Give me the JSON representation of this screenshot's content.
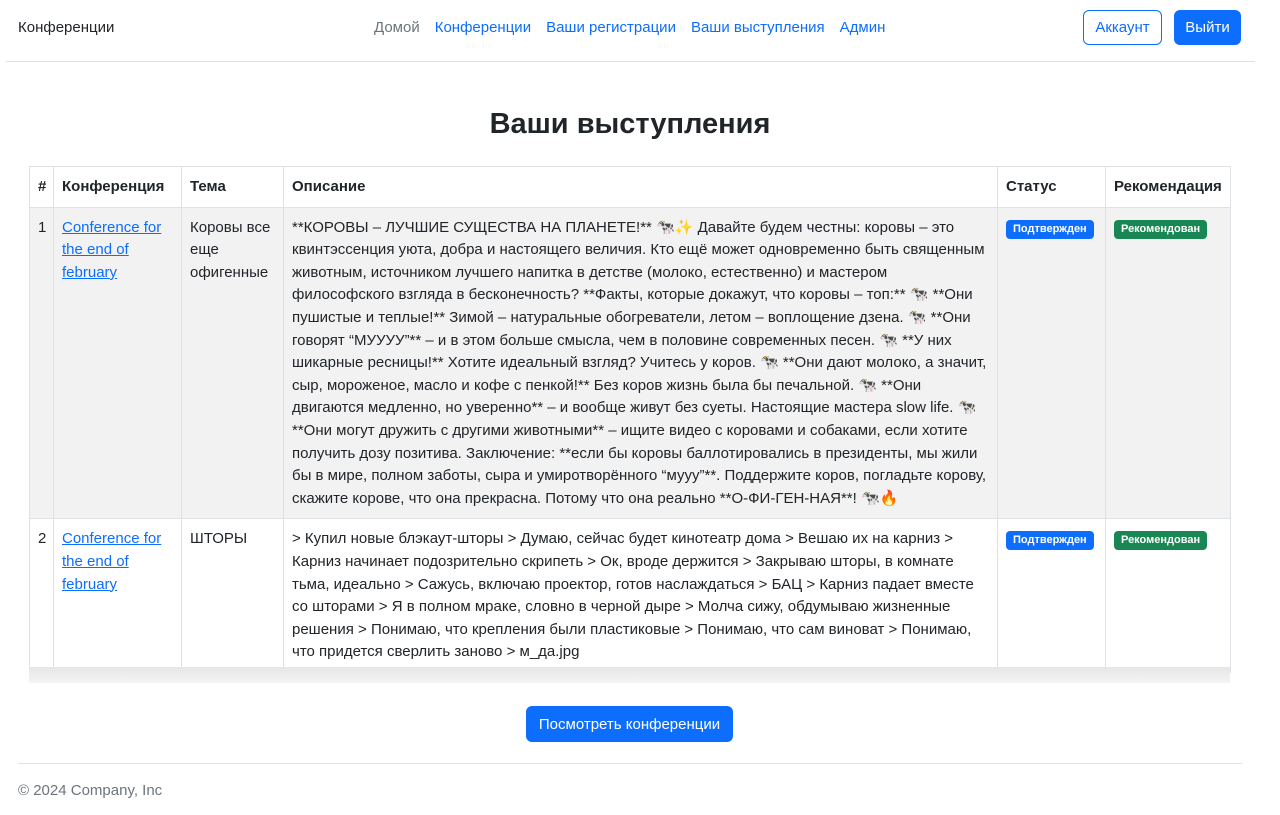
{
  "header": {
    "brand": "Конференции",
    "nav": [
      {
        "label": "Домой"
      },
      {
        "label": "Конференции"
      },
      {
        "label": "Ваши регистрации"
      },
      {
        "label": "Ваши выступления"
      },
      {
        "label": "Админ"
      }
    ],
    "account_label": "Аккаунт",
    "logout_label": "Выйти"
  },
  "page": {
    "title": "Ваши выступления"
  },
  "table": {
    "headers": [
      "#",
      "Конференция",
      "Тема",
      "Описание",
      "Статус",
      "Рекомендация"
    ],
    "rows": [
      {
        "num": "1",
        "conference": "Conference for the end of february",
        "topic": "Коровы все еще офигенные",
        "description": "**КОРОВЫ – ЛУЧШИЕ СУЩЕСТВА НА ПЛАНЕТЕ!** 🐄✨ Давайте будем честны: коровы – это квинтэссенция уюта, добра и настоящего величия. Кто ещё может одновременно быть священным животным, источником лучшего напитка в детстве (молоко, естественно) и мастером философского взгляда в бесконечность? **Факты, которые докажут, что коровы – топ:** 🐄 **Они пушистые и теплые!** Зимой – натуральные обогреватели, летом – воплощение дзена. 🐄 **Они говорят “МУУУУ”** – и в этом больше смысла, чем в половине современных песен. 🐄 **У них шикарные ресницы!** Хотите идеальный взгляд? Учитесь у коров. 🐄 **Они дают молоко, а значит, сыр, мороженое, масло и кофе с пенкой!** Без коров жизнь была бы печальной. 🐄 **Они двигаются медленно, но уверенно** – и вообще живут без суеты. Настоящие мастера slow life. 🐄 **Они могут дружить с другими животными** – ищите видео с коровами и собаками, если хотите получить дозу позитива. Заключение: **если бы коровы баллотировались в президенты, мы жили бы в мире, полном заботы, сыра и умиротворённого “мууу”**. Поддержите коров, погладьте корову, скажите корове, что она прекрасна. Потому что она реально **О-ФИ-ГЕН-НАЯ**! 🐄🔥",
        "status": "Подтвержден",
        "recommendation": "Рекомендован"
      },
      {
        "num": "2",
        "conference": "Conference for the end of february",
        "topic": "ШТОРЫ",
        "description": "> Купил новые блэкаут-шторы > Думаю, сейчас будет кинотеатр дома > Вешаю их на карниз > Карниз начинает подозрительно скрипеть > Ок, вроде держится > Закрываю шторы, в комнате тьма, идеально > Сажусь, включаю проектор, готов наслаждаться > БАЦ > Карниз падает вместе со шторами > Я в полном мраке, словно в черной дыре > Молча сижу, обдумываю жизненные решения > Понимаю, что крепления были пластиковые > Понимаю, что сам виноват > Понимаю, что придется сверлить заново > м_да.jpg",
        "status": "Подтвержден",
        "recommendation": "Рекомендован"
      }
    ]
  },
  "view_conferences_label": "Посмотреть конференции",
  "footer": {
    "text": "© 2024 Company, Inc"
  },
  "colors": {
    "primary": "#0d6efd",
    "success": "#198754",
    "muted": "#6c757d"
  }
}
